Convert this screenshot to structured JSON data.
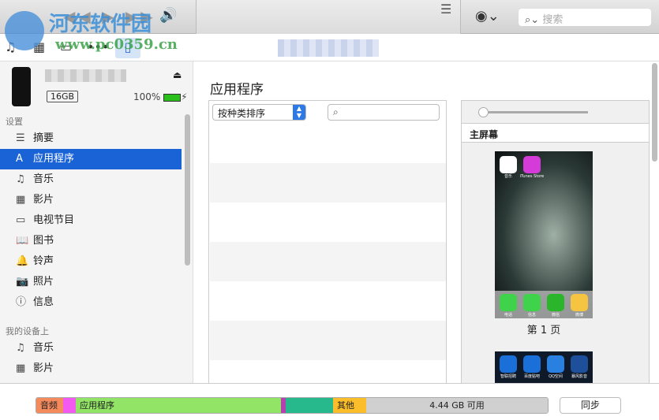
{
  "toolbar": {
    "search_placeholder": "搜索",
    "icons": [
      "play-controls",
      "volume-icon",
      "apple-logo",
      "list-icon",
      "account-icon",
      "search-icon"
    ]
  },
  "watermark": {
    "name": "河东软件园",
    "url": "www.pc0359.cn"
  },
  "media_bar": {
    "icons": [
      "music-icon",
      "movie-icon",
      "tv-icon",
      "more-icon",
      "iphone-icon"
    ]
  },
  "device": {
    "capacity": "16GB",
    "battery": "100%",
    "battery_level": 100
  },
  "sidebar": {
    "settings_header": "设置",
    "settings": [
      {
        "label": "摘要",
        "icon": "list-icon"
      },
      {
        "label": "应用程序",
        "icon": "apps-icon",
        "selected": true
      },
      {
        "label": "音乐",
        "icon": "music-icon"
      },
      {
        "label": "影片",
        "icon": "film-icon"
      },
      {
        "label": "电视节目",
        "icon": "tv-icon"
      },
      {
        "label": "图书",
        "icon": "book-icon"
      },
      {
        "label": "铃声",
        "icon": "bell-icon"
      },
      {
        "label": "照片",
        "icon": "camera-icon"
      },
      {
        "label": "信息",
        "icon": "info-icon"
      }
    ],
    "mydevice_header": "我的设备上",
    "mydevice": [
      {
        "label": "音乐",
        "icon": "music-icon"
      },
      {
        "label": "影片",
        "icon": "film-icon"
      }
    ]
  },
  "main": {
    "title": "应用程序",
    "sort_label": "按种类排序",
    "home_screen": "主屏幕",
    "page_label": "第 1 页",
    "apps_page1": [
      "音乐",
      "iTunes Store"
    ],
    "dock": [
      "电话",
      "信息",
      "微信",
      "微博"
    ],
    "apps_page2": [
      "智联招聘",
      "百度贴吧",
      "QQ空间",
      "暴风影音"
    ]
  },
  "storage": {
    "segments": [
      {
        "label": "音频",
        "color": "#f58a5c"
      },
      {
        "label": "",
        "color": "#f25af0"
      },
      {
        "label": "应用程序",
        "color": "#92e466"
      },
      {
        "label": "",
        "color": "#b540b0"
      },
      {
        "label": "",
        "color": "#27b98c"
      },
      {
        "label": "其他",
        "color": "#fbbd2a"
      }
    ],
    "free": "4.44 GB 可用",
    "free_color": "#d0d0d0"
  },
  "sync_label": "同步",
  "accent": "#1a63d6"
}
